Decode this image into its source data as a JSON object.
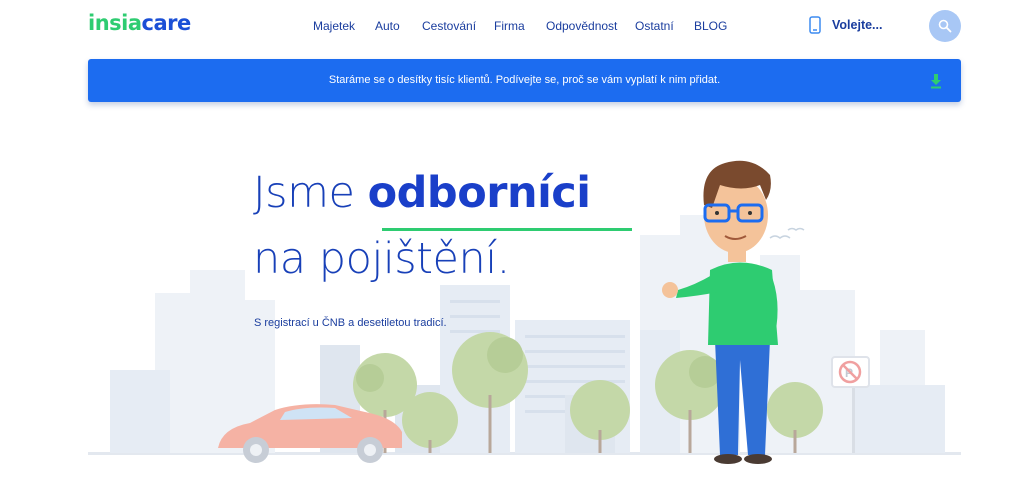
{
  "brand": {
    "logo_part1": "insia",
    "logo_part2": "care",
    "color_green": "#2ecc71",
    "color_blue": "#1a4fd6"
  },
  "nav": {
    "items": [
      "Majetek",
      "Auto",
      "Cestování",
      "Firma",
      "Odpovědnost",
      "Ostatní",
      "BLOG"
    ]
  },
  "header": {
    "call_label": "Volejte...",
    "phone_icon": "phone-icon",
    "search_icon": "search-icon"
  },
  "banner": {
    "text": "Staráme se o desítky tisíc klientů. Podívejte se, proč se vám vyplatí k nim přidat.",
    "icon": "download-icon",
    "color": "#1c6cf0"
  },
  "hero": {
    "title_part1": "Jsme ",
    "title_strong": "odborníci",
    "title_line2": "na pojištění.",
    "subtitle": "S registrací u ČNB a desetiletou tradicí.",
    "accent": "#2ecc71"
  }
}
